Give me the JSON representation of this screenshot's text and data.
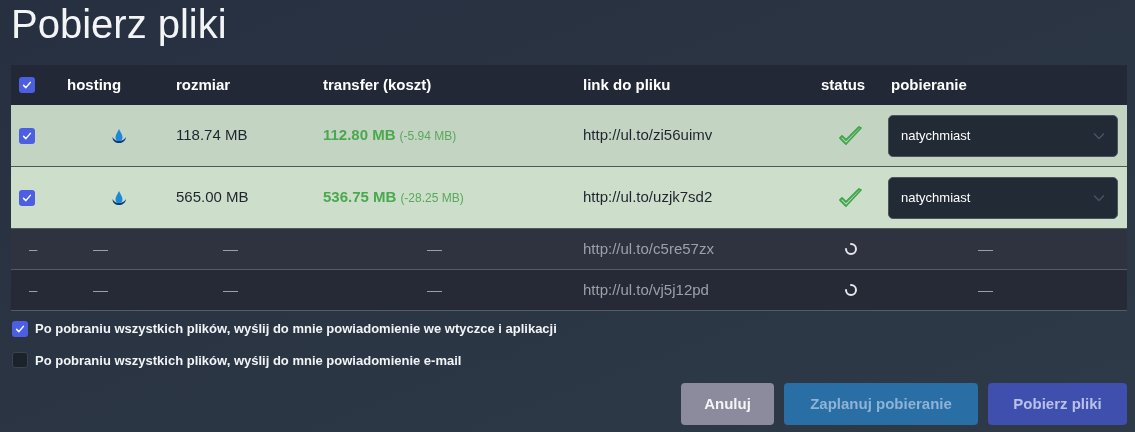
{
  "title": "Pobierz pliki",
  "table": {
    "select_all": {
      "checked": true
    },
    "columns": [
      "hosting",
      "rozmiar",
      "transfer (koszt)",
      "link do pliku",
      "status",
      "pobieranie"
    ],
    "rows": [
      {
        "kind": "ready",
        "checked": true,
        "size": "118.74 MB",
        "transfer": "112.80 MB",
        "saving": "(-5.94 MB)",
        "link": "http://ul.to/zi56uimv",
        "mode": "natychmiast"
      },
      {
        "kind": "ready",
        "checked": true,
        "size": "565.00 MB",
        "transfer": "536.75 MB",
        "saving": "(-28.25 MB)",
        "link": "http://ul.to/uzjk7sd2",
        "mode": "natychmiast"
      },
      {
        "kind": "loading",
        "placeholders": [
          "–",
          "—",
          "—",
          "—",
          "—"
        ],
        "link": "http://ul.to/c5re57zx"
      },
      {
        "kind": "loading",
        "placeholders": [
          "–",
          "—",
          "—",
          "—",
          "—"
        ],
        "link": "http://ul.to/vj5j12pd"
      }
    ]
  },
  "options": [
    {
      "label": "Po pobraniu wszystkich plików, wyślij do mnie powiadomienie we wtyczce i aplikacji",
      "checked": true
    },
    {
      "label": "Po pobraniu wszystkich plików, wyślij do mnie powiadomienie e-mail",
      "checked": false
    }
  ],
  "buttons": [
    {
      "label": "Anuluj",
      "kind": "cancel"
    },
    {
      "label": "Zaplanuj pobieranie",
      "kind": "schedule"
    },
    {
      "label": "Pobierz pliki",
      "kind": "primary"
    }
  ]
}
